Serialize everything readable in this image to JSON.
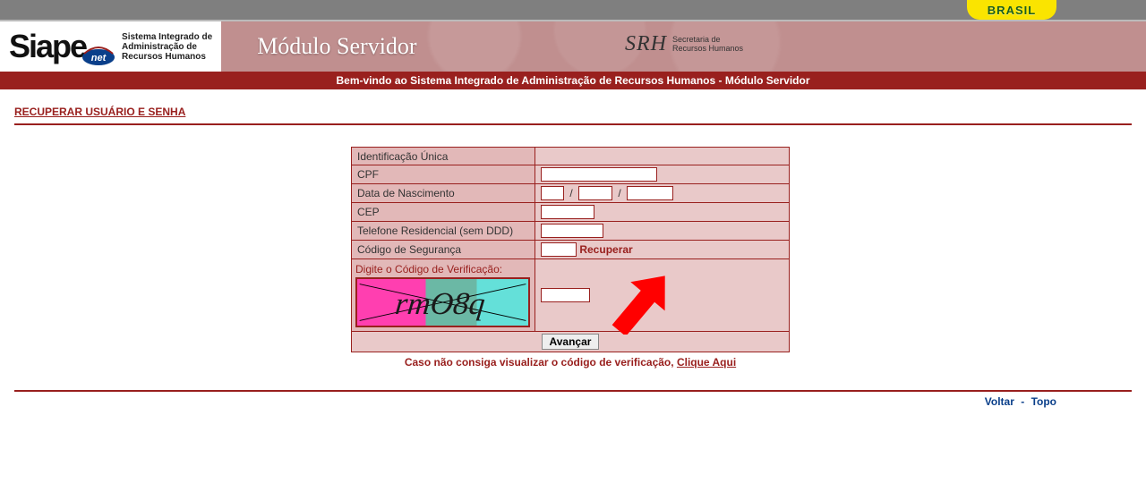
{
  "gov_badge": "BRASIL",
  "logo_text": "Siape",
  "logo_suffix": "net",
  "logo_subtitle_line1": "Sistema Integrado de",
  "logo_subtitle_line2": "Administração de",
  "logo_subtitle_line3": "Recursos Humanos",
  "module_title": "Módulo Servidor",
  "srh_logo": "SRH",
  "srh_sub_line1": "Secretaria de",
  "srh_sub_line2": "Recursos Humanos",
  "welcome_bar": "Bem-vindo ao Sistema Integrado de Administração de Recursos Humanos - Módulo Servidor",
  "page_title": "RECUPERAR USUÁRIO E SENHA",
  "form": {
    "id_unica_label": "Identificação Única",
    "id_unica_value": "",
    "cpf_label": "CPF",
    "cpf_value": "",
    "dob_label": "Data de Nascimento",
    "dob_day": "",
    "dob_month": "",
    "dob_year": "",
    "dob_sep": "/",
    "cep_label": "CEP",
    "cep_value": "",
    "phone_label": "Telefone Residencial (sem DDD)",
    "phone_value": "",
    "sec_code_label": "Código de Segurança",
    "sec_code_value": "",
    "recover_link": "Recuperar",
    "verify_label": "Digite o Código de Verificação:",
    "captcha_text": "rmO8q",
    "verify_value": "",
    "submit_label": "Avançar"
  },
  "click_here_line_prefix": "Caso não consiga visualizar o código de verificação, ",
  "click_here_link": "Clique Aqui",
  "footer": {
    "back": "Voltar",
    "sep": " - ",
    "top": "Topo"
  }
}
